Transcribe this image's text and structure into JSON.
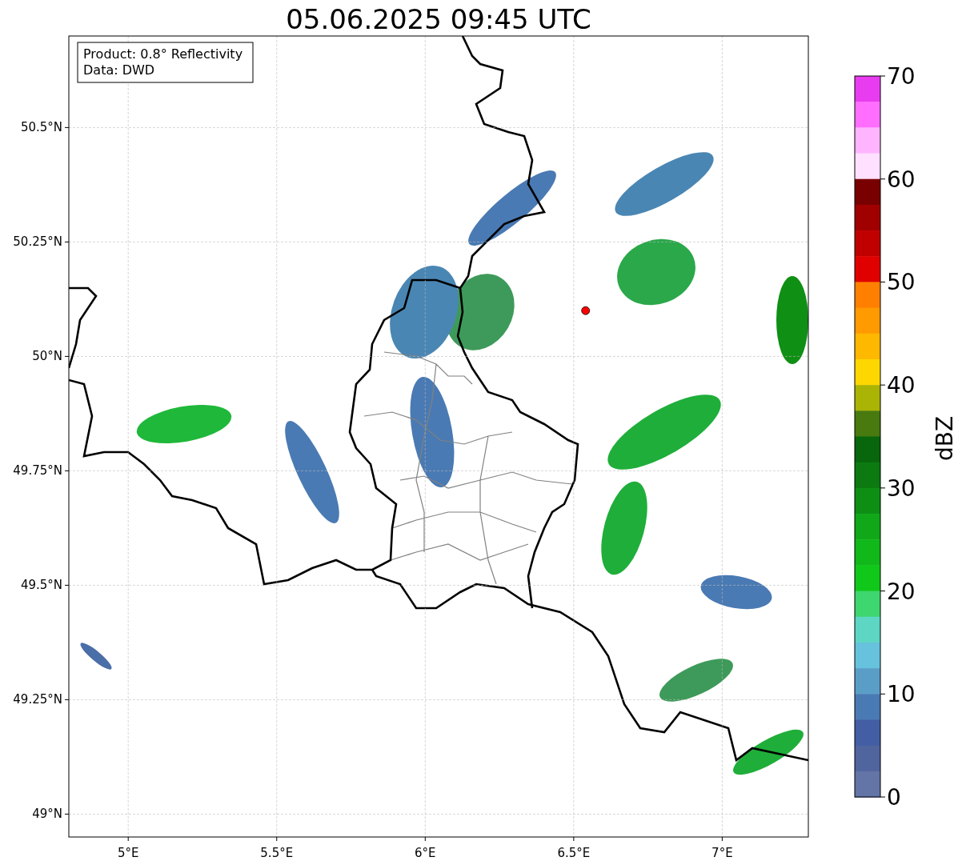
{
  "title": "05.06.2025 09:45 UTC",
  "info_box": [
    "Product: 0.8° Reflectivity",
    "Data: DWD"
  ],
  "map": {
    "chart_data": {
      "type": "scatter",
      "xlim": [
        4.8,
        7.29
      ],
      "ylim": [
        48.95,
        50.7
      ],
      "xticks": [
        {
          "value": 5,
          "label": "5°E"
        },
        {
          "value": 5.5,
          "label": "5.5°E"
        },
        {
          "value": 6,
          "label": "6°E"
        },
        {
          "value": 6.5,
          "label": "6.5°E"
        },
        {
          "value": 7,
          "label": "7°E"
        }
      ],
      "yticks": [
        {
          "value": 49,
          "label": "49°N"
        },
        {
          "value": 49.25,
          "label": "49.25°N"
        },
        {
          "value": 49.5,
          "label": "49.5°N"
        },
        {
          "value": 49.75,
          "label": "49.75°N"
        },
        {
          "value": 50,
          "label": "50°N"
        },
        {
          "value": 50.25,
          "label": "50.25°N"
        },
        {
          "value": 50.5,
          "label": "50.5°N"
        }
      ],
      "grid": true,
      "x": [
        6.54
      ],
      "series": [
        {
          "color": "#ff0000",
          "values": [
            50.1
          ]
        }
      ]
    }
  },
  "colorbar": {
    "label": "dBZ",
    "ticks": [
      "70",
      "60",
      "50",
      "40",
      "30",
      "20",
      "10",
      "0"
    ],
    "bins": [
      {
        "color": "#e83cf0"
      },
      {
        "color": "#ff6eff"
      },
      {
        "color": "#ffb4ff"
      },
      {
        "color": "#ffe0ff"
      },
      {
        "color": "#780000"
      },
      {
        "color": "#a00000"
      },
      {
        "color": "#c00000"
      },
      {
        "color": "#e00000"
      },
      {
        "color": "#ff8000"
      },
      {
        "color": "#ff9a00"
      },
      {
        "color": "#ffb800"
      },
      {
        "color": "#ffd700"
      },
      {
        "color": "#aab404"
      },
      {
        "color": "#487a10"
      },
      {
        "color": "#08660c"
      },
      {
        "color": "#0c7a10"
      },
      {
        "color": "#0e8f14"
      },
      {
        "color": "#10a818"
      },
      {
        "color": "#10b81a"
      },
      {
        "color": "#10c81a"
      },
      {
        "color": "#3ed66e"
      },
      {
        "color": "#5ed6c4"
      },
      {
        "color": "#66c2dd"
      },
      {
        "color": "#5a9ec8"
      },
      {
        "color": "#4a7ab3"
      },
      {
        "color": "#435ea4"
      },
      {
        "color": "#50649e"
      },
      {
        "color": "#6374a6"
      }
    ]
  }
}
